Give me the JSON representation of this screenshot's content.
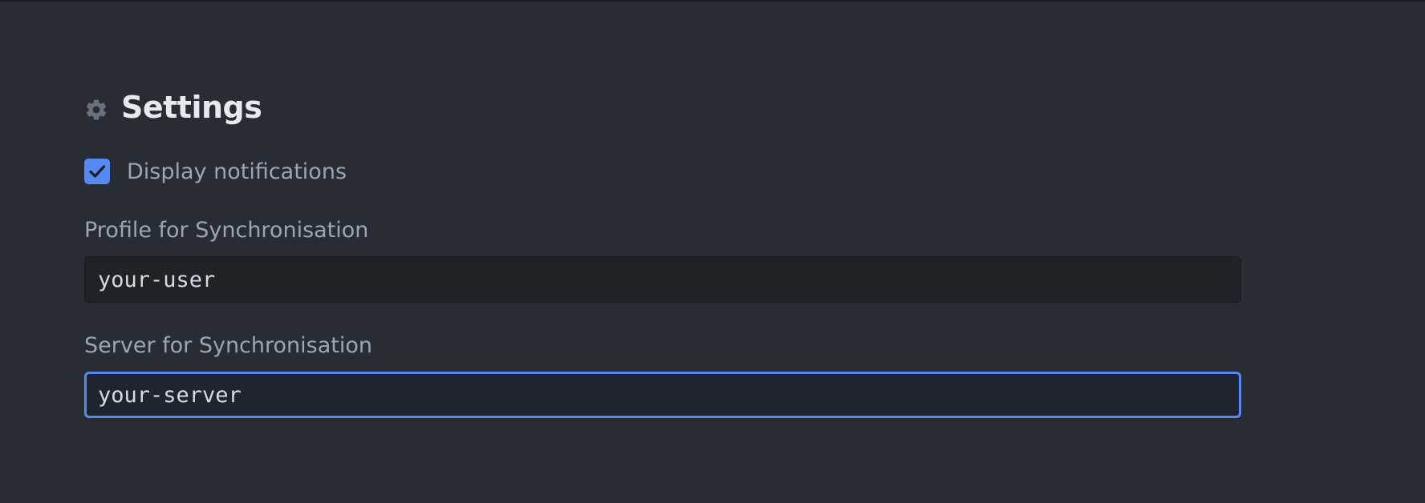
{
  "settings": {
    "title": "Settings",
    "icon": "gear-icon",
    "accent_color": "#568af2",
    "display_notifications": {
      "label": "Display notifications",
      "checked": true
    },
    "profile": {
      "label": "Profile for Synchronisation",
      "value": "your-user"
    },
    "server": {
      "label": "Server for Synchronisation",
      "value": "your-server",
      "focused": true
    }
  }
}
